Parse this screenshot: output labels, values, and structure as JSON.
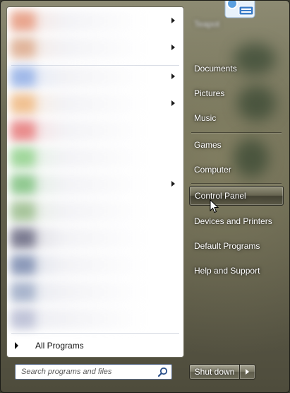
{
  "left_pane": {
    "pinned": [
      {
        "has_arrow": true,
        "color": "#e8a48c"
      },
      {
        "has_arrow": true,
        "color": "#e0b49a"
      }
    ],
    "recent": [
      {
        "has_arrow": true,
        "color": "#9fb8e8"
      },
      {
        "has_arrow": true,
        "color": "#f0c090"
      },
      {
        "has_arrow": false,
        "color": "#e88a8a"
      },
      {
        "has_arrow": false,
        "color": "#9fd69a"
      },
      {
        "has_arrow": true,
        "color": "#8fc88f"
      },
      {
        "has_arrow": false,
        "color": "#a6c49a"
      },
      {
        "has_arrow": false,
        "color": "#7a7a90"
      },
      {
        "has_arrow": false,
        "color": "#8a98b8"
      },
      {
        "has_arrow": false,
        "color": "#a8b4cc"
      },
      {
        "has_arrow": false,
        "color": "#c0c4d8"
      }
    ],
    "all_programs_label": "All Programs",
    "search_placeholder": "Search programs and files"
  },
  "right_pane": {
    "username": "Teapot",
    "items_group1": [
      "Documents",
      "Pictures",
      "Music"
    ],
    "items_group2": [
      "Games",
      "Computer"
    ],
    "items_group3": [
      "Control Panel",
      "Devices and Printers",
      "Default Programs",
      "Help and Support"
    ],
    "hovered_item": "Control Panel"
  },
  "shutdown": {
    "label": "Shut down"
  },
  "colors": {
    "accent_text": "#ffffff",
    "search_border": "#5d6e8c"
  }
}
